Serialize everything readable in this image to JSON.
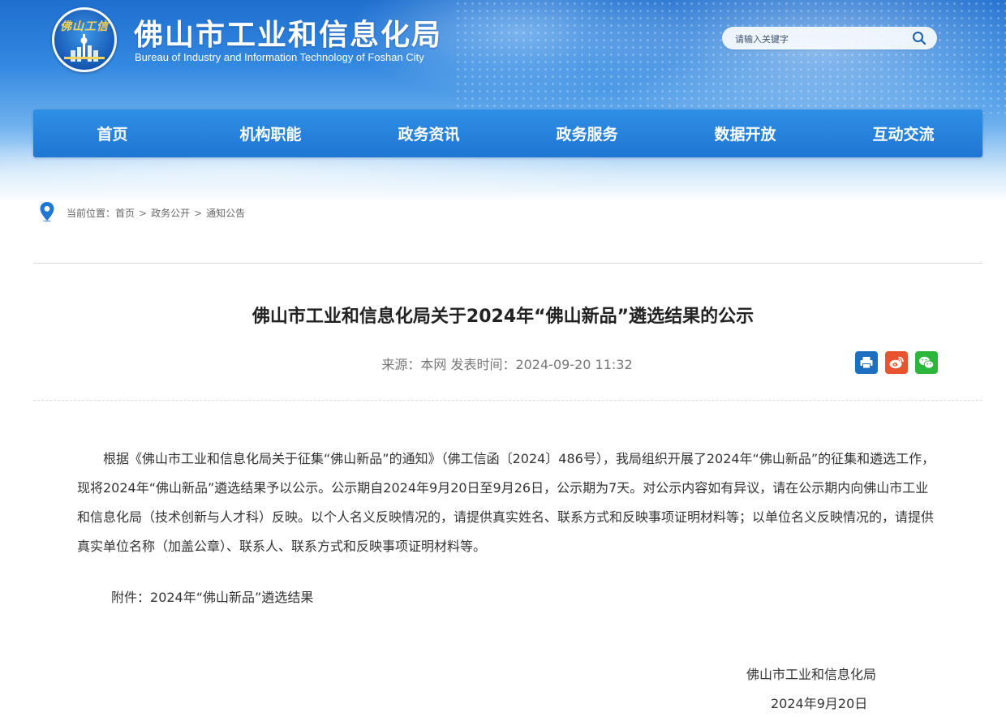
{
  "header": {
    "logo_text": "佛山工信",
    "site_title": "佛山市工业和信息化局",
    "site_subtitle": "Bureau of Industry and Information Technology of Foshan City",
    "search": {
      "placeholder": "请输入关键字",
      "icon": "search-icon"
    }
  },
  "nav": {
    "items": [
      {
        "label": "首页"
      },
      {
        "label": "机构职能"
      },
      {
        "label": "政务资讯"
      },
      {
        "label": "政务服务"
      },
      {
        "label": "数据开放"
      },
      {
        "label": "互动交流"
      }
    ]
  },
  "breadcrumb": {
    "icon": "location-pin-icon",
    "prefix": "当前位置：",
    "items": [
      "首页",
      "政务公开",
      "通知公告"
    ],
    "separator": ">"
  },
  "article": {
    "title": "佛山市工业和信息化局关于2024年“佛山新品”遴选结果的公示",
    "meta": "来源：本网 发表时间：2024-09-20 11:32",
    "share": {
      "print_icon": "printer-icon",
      "weibo_icon": "weibo-icon",
      "wechat_icon": "wechat-icon"
    },
    "paragraph": "根据《佛山市工业和信息化局关于征集“佛山新品”的通知》（佛工信函〔2024〕486号），我局组织开展了2024年“佛山新品”的征集和遴选工作，现将2024年“佛山新品”遴选结果予以公示。公示期自2024年9月20日至9月26日，公示期为7天。对公示内容如有异议，请在公示期内向佛山市工业和信息化局（技术创新与人才科）反映。以个人名义反映情况的，请提供真实姓名、联系方式和反映事项证明材料等；以单位名义反映情况的，请提供真实单位名称（加盖公章）、联系人、联系方式和反映事项证明材料等。",
    "attachment_label": "附件：",
    "attachment_link": "2024年“佛山新品”遴选结果",
    "signature_org": "佛山市工业和信息化局",
    "signature_date": "2024年9月20日"
  },
  "colors": {
    "nav_bg": "#1f76d3",
    "header_blue": "#2a7fdc",
    "print": "#1e6fc0",
    "weibo": "#e8542e",
    "wechat": "#2db53c"
  }
}
